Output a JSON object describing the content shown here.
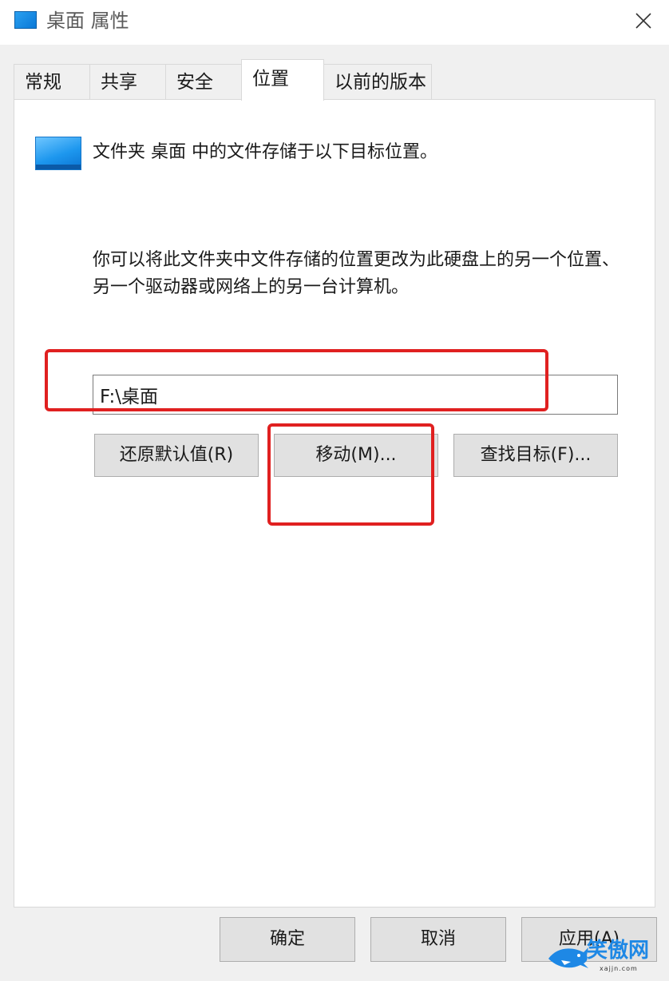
{
  "window": {
    "title": "桌面 属性",
    "close_label": "×"
  },
  "tabs": [
    {
      "label": "常规"
    },
    {
      "label": "共享"
    },
    {
      "label": "安全"
    },
    {
      "label": "位置",
      "active": true
    },
    {
      "label": "以前的版本"
    }
  ],
  "location": {
    "description": "文件夹 桌面 中的文件存储于以下目标位置。",
    "explanation": "你可以将此文件夹中文件存储的位置更改为此硬盘上的另一个位置、另一个驱动器或网络上的另一台计算机。",
    "path_value": "F:\\桌面",
    "restore_button": "还原默认值(R)",
    "move_button": "移动(M)...",
    "find_button": "查找目标(F)..."
  },
  "footer": {
    "ok_button": "确定",
    "cancel_button": "取消",
    "apply_button": "应用(A)"
  },
  "watermark": {
    "text": "笑傲网",
    "subtext": "xajjn.com"
  },
  "colors": {
    "annotation": "#e02020",
    "folder_icon": "#1d97ee"
  }
}
